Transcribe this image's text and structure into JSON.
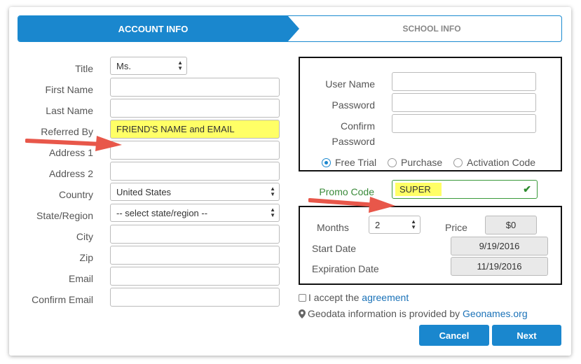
{
  "steps": {
    "active": "ACCOUNT INFO",
    "inactive": "SCHOOL INFO"
  },
  "left": {
    "title_label": "Title",
    "title_value": "Ms.",
    "first_name_label": "First Name",
    "last_name_label": "Last Name",
    "referred_by_label": "Referred By",
    "referred_by_value": "FRIEND'S NAME and EMAIL",
    "address1_label": "Address 1",
    "address2_label": "Address 2",
    "country_label": "Country",
    "country_value": "United States",
    "state_label": "State/Region",
    "state_value": "-- select state/region --",
    "city_label": "City",
    "zip_label": "Zip",
    "email_label": "Email",
    "confirm_email_label": "Confirm Email"
  },
  "account": {
    "username_label": "User Name",
    "password_label": "Password",
    "confirm_password_label_1": "Confirm",
    "confirm_password_label_2": "Password",
    "radio_free_trial": "Free Trial",
    "radio_purchase": "Purchase",
    "radio_activation": "Activation Code"
  },
  "promo": {
    "label": "Promo Code",
    "value": "SUPER"
  },
  "purchase": {
    "months_label": "Months",
    "months_value": "2",
    "price_label": "Price",
    "price_value": "$0",
    "start_label": "Start Date",
    "start_value": "9/19/2016",
    "expiration_label": "Expiration Date",
    "expiration_value": "11/19/2016"
  },
  "agreement": {
    "prefix": "I accept the",
    "link": "agreement"
  },
  "geodata": {
    "text": "Geodata information is provided by",
    "link": "Geonames.org"
  },
  "buttons": {
    "cancel": "Cancel",
    "next": "Next"
  },
  "colors": {
    "accent": "#1a87ce",
    "highlight": "#ffff66",
    "annotation_arrow": "#e8574a",
    "check": "#2e8b2e"
  }
}
